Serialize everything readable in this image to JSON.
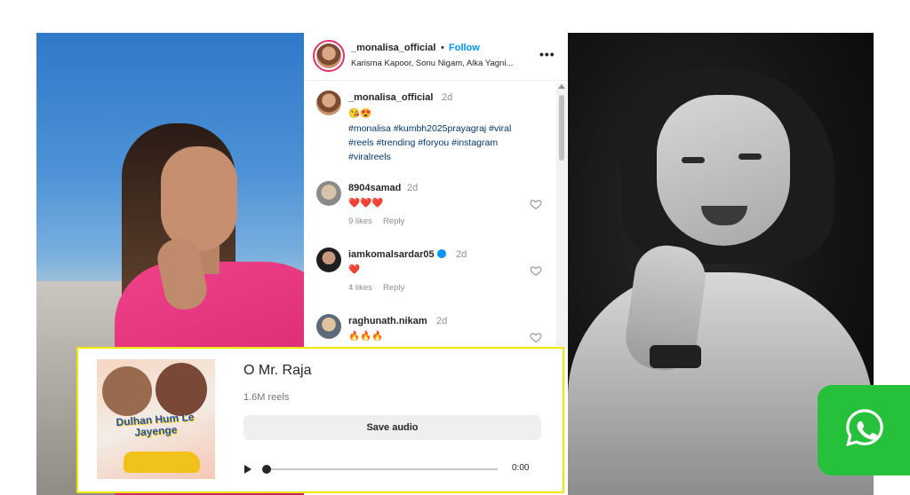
{
  "post": {
    "header": {
      "username": "_monalisa_official",
      "separator": "•",
      "follow_label": "Follow",
      "subtitle": "Karisma Kapoor, Sonu Nigam, Alka Yagni...",
      "more_icon": "more-horizontal-icon"
    },
    "caption": {
      "username": "_monalisa_official",
      "time": "2d",
      "emojis": "😘😍",
      "hashtags": "#monalisa #kumbh2025prayagraj #viral #reels #trending #foryou #instagram #viralreels"
    },
    "comments": [
      {
        "username": "8904samad",
        "time": "2d",
        "text": "❤️❤️❤️",
        "likes": "9 likes",
        "reply": "Reply",
        "verified": false
      },
      {
        "username": "iamkomalsardar05",
        "time": "2d",
        "text": "❤️",
        "likes": "4 likes",
        "reply": "Reply",
        "verified": true
      },
      {
        "username": "raghunath.nikam",
        "time": "2d",
        "text": "🔥🔥🔥",
        "likes": "",
        "reply": "",
        "verified": false
      }
    ]
  },
  "audio": {
    "song_title": "O Mr. Raja",
    "reel_count": "1.6M reels",
    "save_label": "Save audio",
    "time": "0:00",
    "progress": 0,
    "album_art_text": "Dulhan Hum Le Jayenge"
  },
  "whatsapp": {
    "icon": "whatsapp-icon"
  },
  "colors": {
    "follow_blue": "#0095f6",
    "highlight_border": "#f3e600",
    "whatsapp_green": "#25c13a",
    "hashtag": "#00376b"
  }
}
